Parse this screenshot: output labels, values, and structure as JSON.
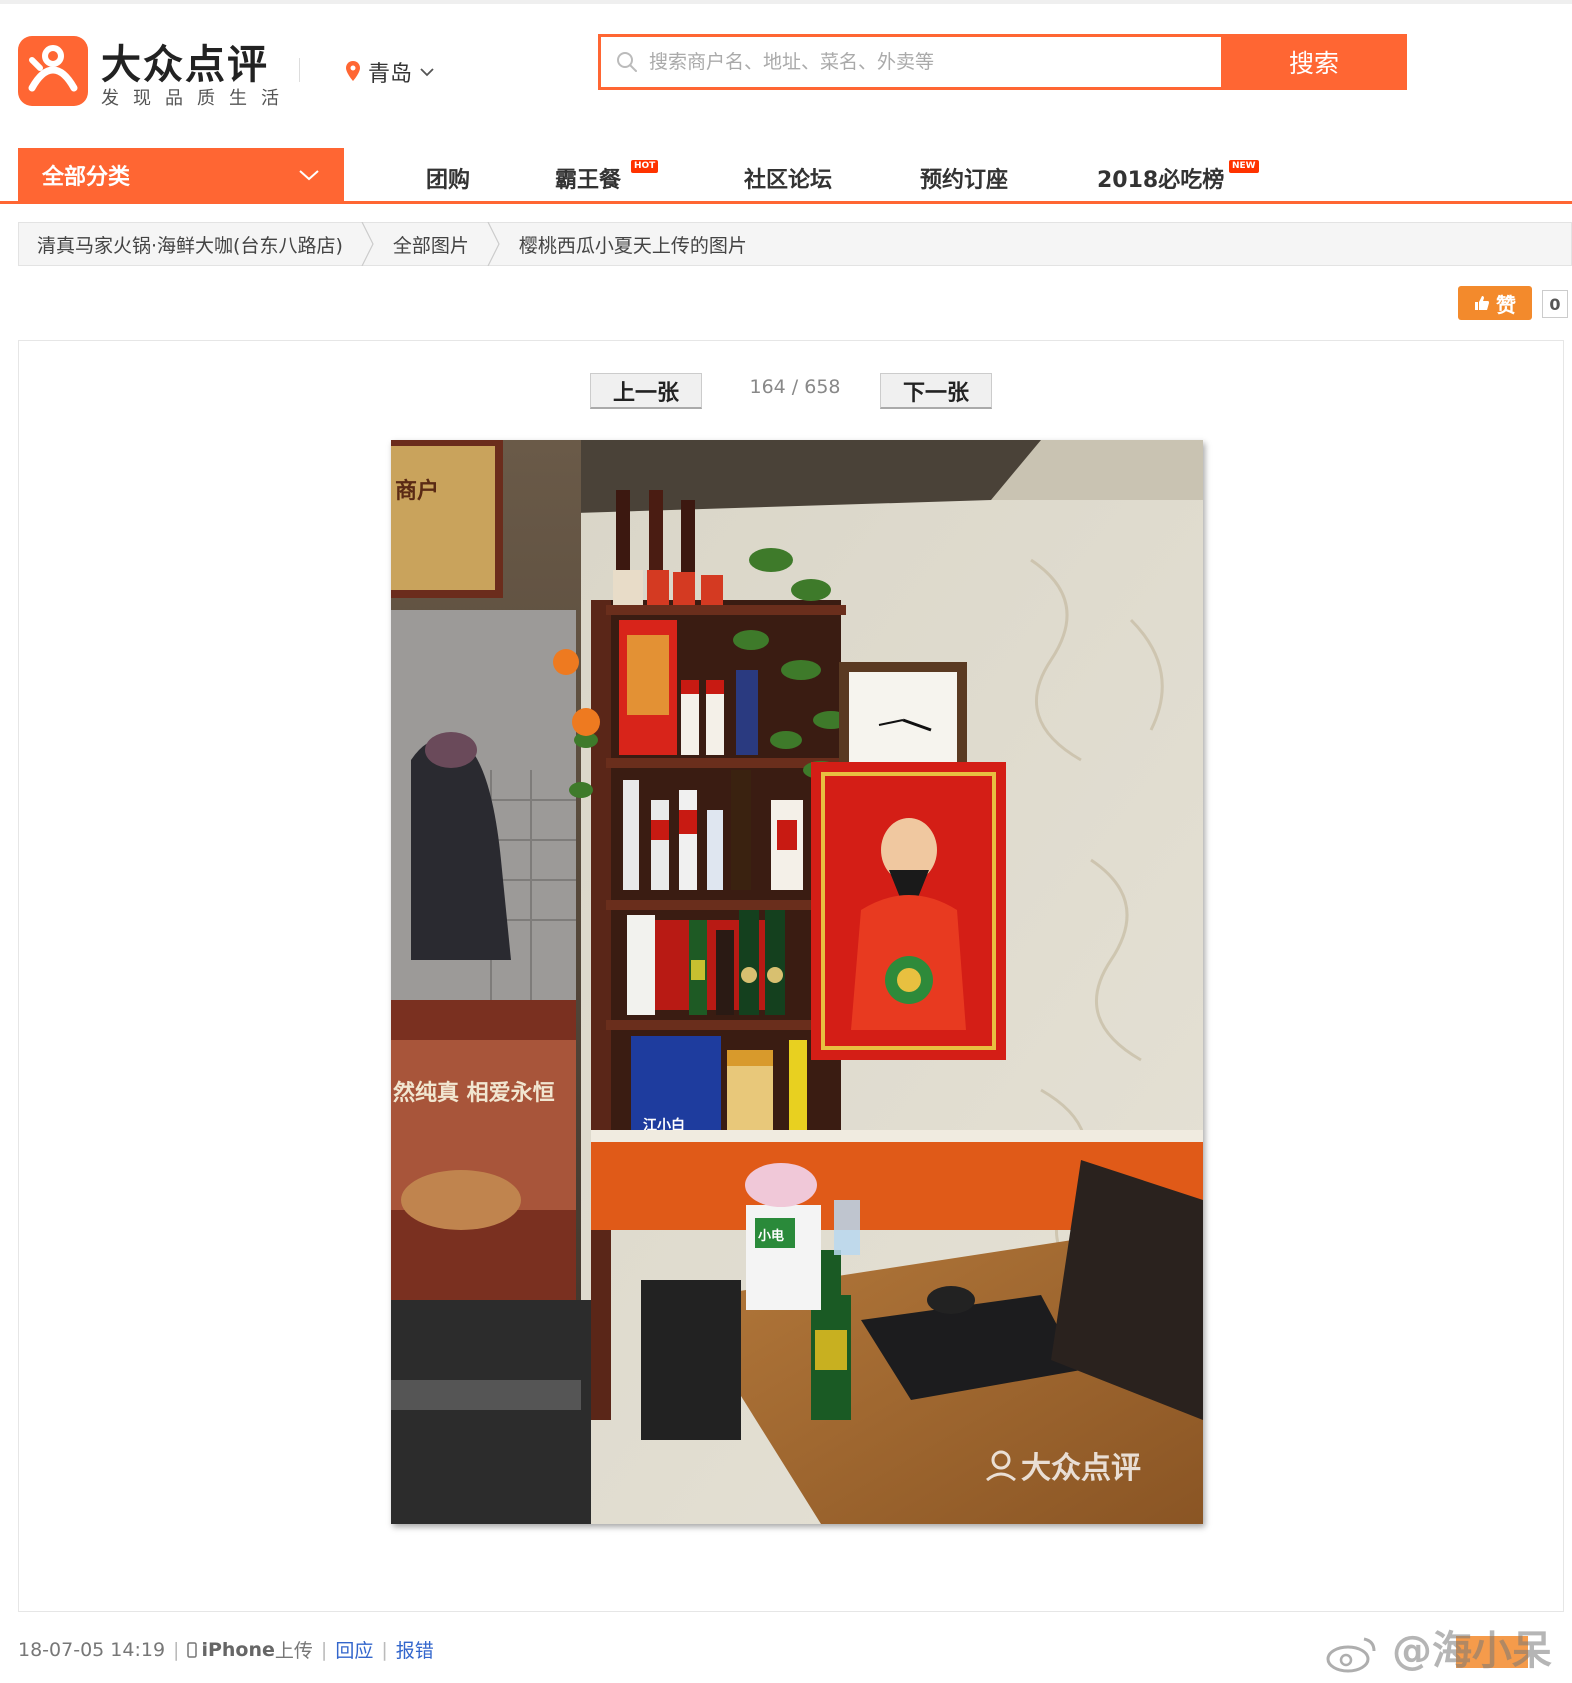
{
  "brand": {
    "name": "大众点评",
    "slogan": "发现品质生活",
    "accent_color": "#ff6633"
  },
  "header": {
    "city": "青岛",
    "search": {
      "placeholder": "搜索商户名、地址、菜名、外卖等",
      "button_label": "搜索"
    }
  },
  "nav": {
    "all_categories": "全部分类",
    "items": [
      {
        "label": "团购",
        "badge": ""
      },
      {
        "label": "霸王餐",
        "badge": "HOT"
      },
      {
        "label": "社区论坛",
        "badge": ""
      },
      {
        "label": "预约订座",
        "badge": ""
      },
      {
        "label": "2018必吃榜",
        "badge": "NEW"
      }
    ]
  },
  "breadcrumb": [
    "清真马家火锅·海鲜大咖(台东八路店)",
    "全部图片",
    "樱桃西瓜小夏天上传的图片"
  ],
  "like": {
    "label": "赞",
    "count": "0"
  },
  "viewer": {
    "prev_label": "上一张",
    "next_label": "下一张",
    "counter": "164 / 658",
    "watermark": "大众点评",
    "photo_texts": {
      "sign": "商户",
      "freezer": "然纯真  相爱永恒",
      "box": "江小白",
      "charger": "小电"
    }
  },
  "footer": {
    "datetime": "18-07-05 14:19",
    "device": "iPhone",
    "upload_suffix": "上传",
    "reply": "回应",
    "report": "报错",
    "weibo_watermark": "@海小呆"
  }
}
